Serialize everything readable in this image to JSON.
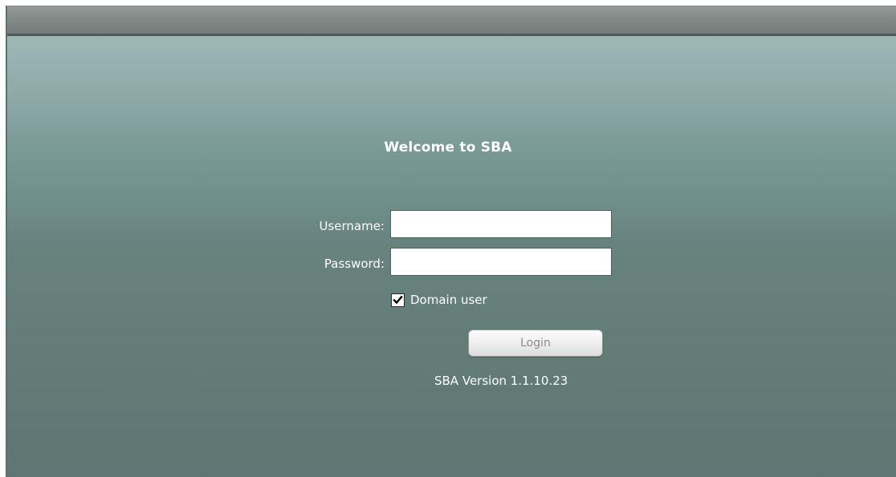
{
  "login": {
    "welcome": "Welcome to SBA",
    "username_label": "Username:",
    "username_value": "",
    "password_label": "Password:",
    "password_value": "",
    "domain_user_label": "Domain user",
    "domain_user_checked": true,
    "login_label": "Login",
    "version": "SBA Version 1.1.10.23"
  },
  "colors": {
    "background_top": "#9db7b5",
    "background_bottom": "#5e7673",
    "titlebar": "#7f8886",
    "text": "#ffffff"
  },
  "icons": {
    "checkbox": "checkmark-icon"
  }
}
